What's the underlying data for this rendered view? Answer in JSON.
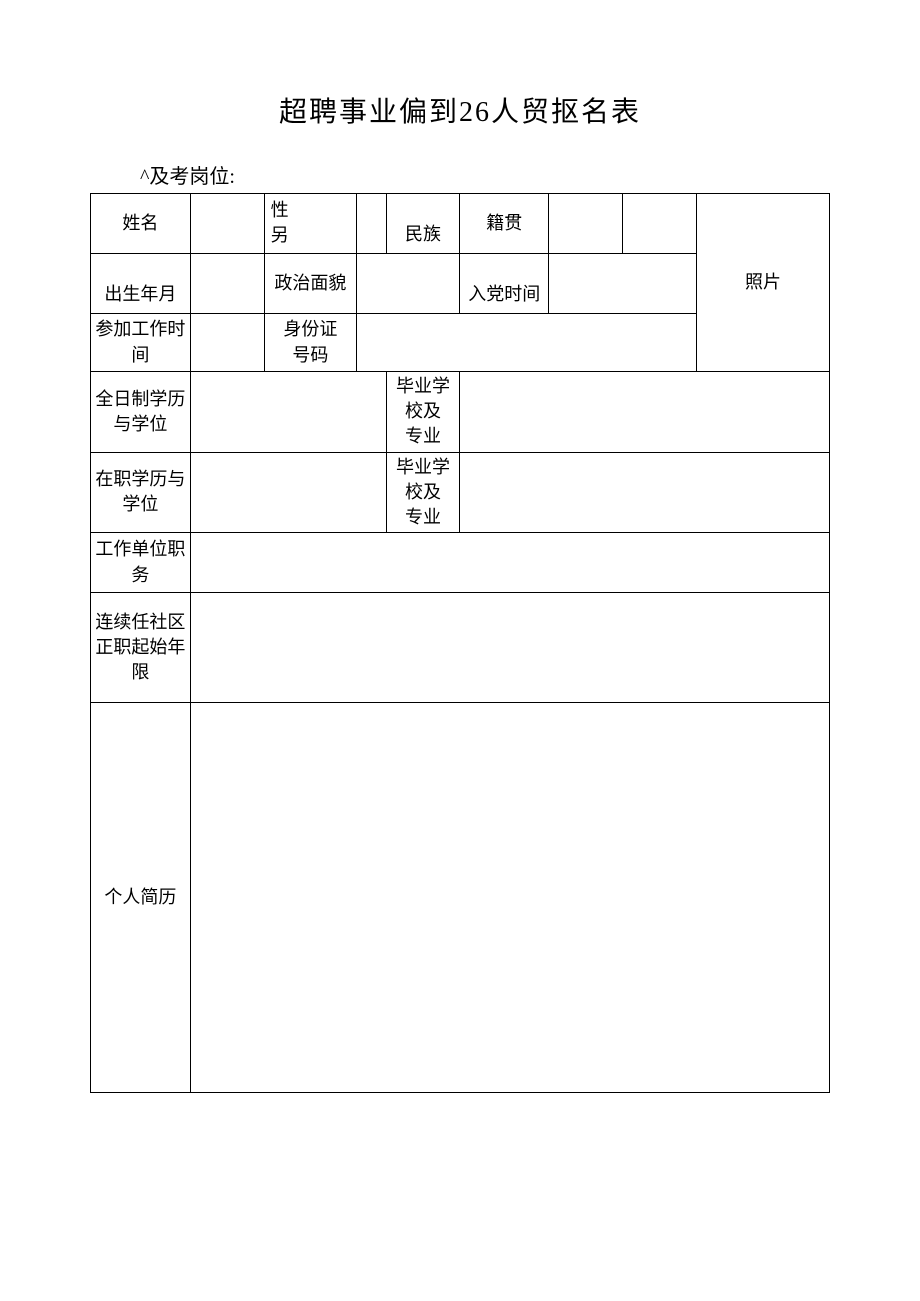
{
  "title": "超聘事业偏到26人贸抠名表",
  "position_label": "^及考岗位:",
  "labels": {
    "name": "姓名",
    "gender": "性\n另",
    "ethnicity": "民族",
    "native_place": "籍贯",
    "photo": "照片",
    "birth": "出生年月",
    "political_status": "政治面貌",
    "party_date": "入党时间",
    "work_start": "参加工作时\n间",
    "id_number": "身份证\n号码",
    "fulltime_edu": "全日制学历\n与学位",
    "grad_school_major_1": "毕业学校及\n专业",
    "inservice_edu": "在职学历与\n学位",
    "grad_school_major_2": "毕业学校及\n专业",
    "work_unit_position": "工作单位职\n务",
    "tenure_start": "连续任社区\n正职起始年\n限",
    "resume": "个人简历"
  },
  "values": {
    "name": "",
    "gender": "",
    "ethnicity": "",
    "native_place": "",
    "birth": "",
    "political_status": "",
    "party_date": "",
    "work_start": "",
    "id_number": "",
    "fulltime_edu": "",
    "grad_school_major_1": "",
    "inservice_edu": "",
    "grad_school_major_2": "",
    "work_unit_position": "",
    "tenure_start": "",
    "resume": ""
  }
}
